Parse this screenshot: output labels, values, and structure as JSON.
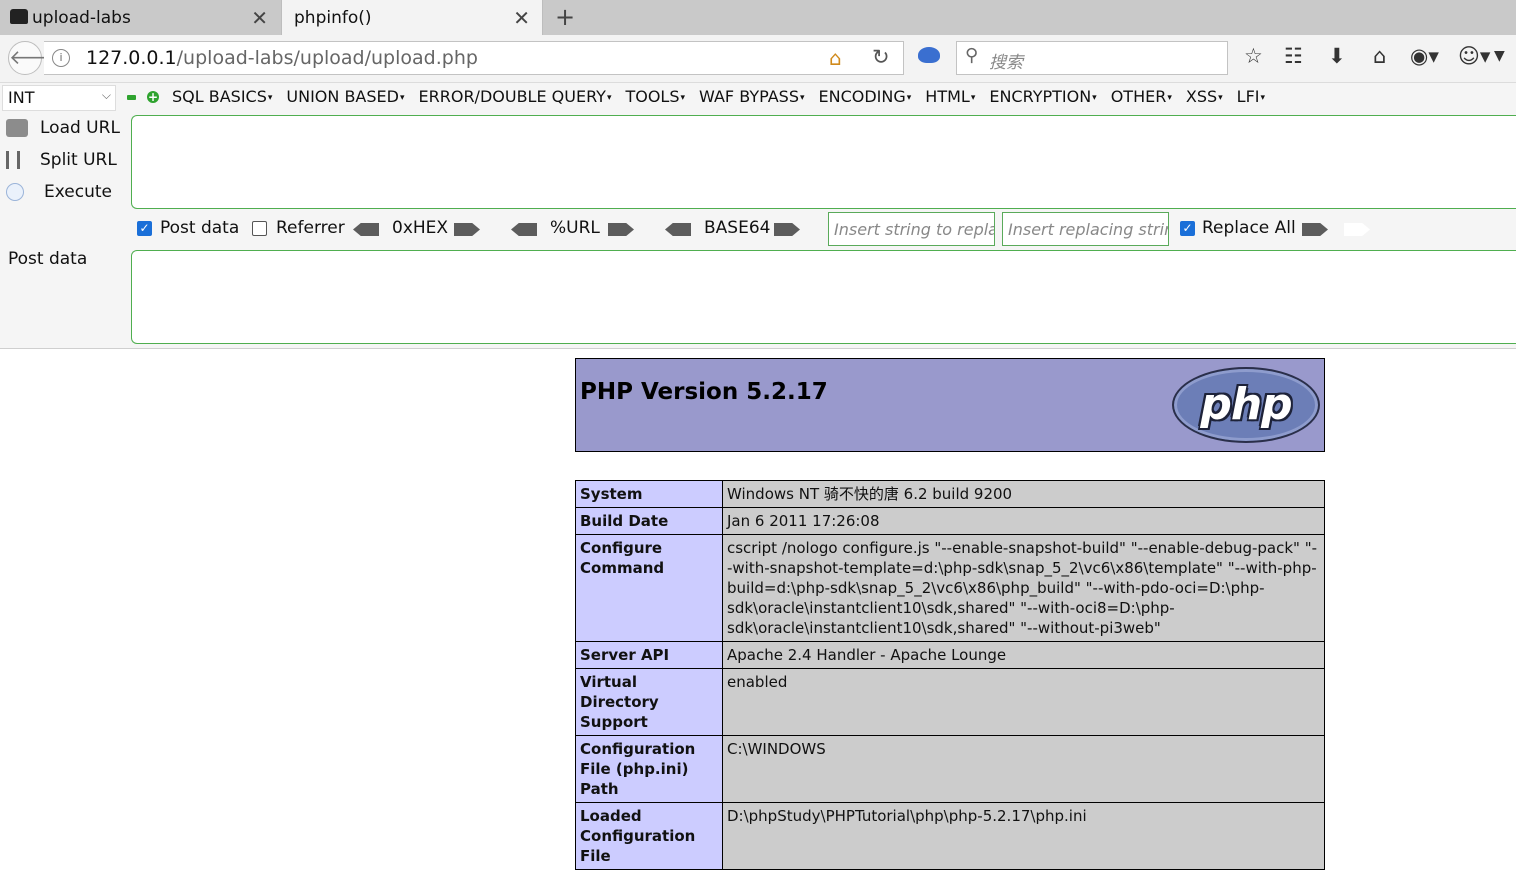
{
  "tabs": [
    {
      "title": "upload-labs"
    },
    {
      "title": "phpinfo()"
    }
  ],
  "navbar": {
    "url_host": "127.0.0.1",
    "url_path": "/upload-labs/upload/upload.php",
    "search_placeholder": "搜索"
  },
  "hackbar": {
    "type_select": "INT",
    "menus": [
      "SQL BASICS",
      "UNION BASED",
      "ERROR/DOUBLE QUERY",
      "TOOLS",
      "WAF BYPASS",
      "ENCODING",
      "HTML",
      "ENCRYPTION",
      "OTHER",
      "XSS",
      "LFI"
    ],
    "load_url": "Load URL",
    "split_url": "Split URL",
    "execute": "Execute",
    "post_data_check": "Post data",
    "post_data_checked": true,
    "referrer_check": "Referrer",
    "referrer_checked": false,
    "hex_label": "0xHEX",
    "url_label": "%URL",
    "base64_label": "BASE64",
    "replace_placeholder": "Insert string to replace",
    "replacing_placeholder": "Insert replacing string",
    "replace_all": "Replace All",
    "replace_all_checked": true,
    "post_data_label": "Post data"
  },
  "phpinfo": {
    "version": "PHP Version 5.2.17",
    "logo_text": "php",
    "rows": [
      {
        "key": "System",
        "value": "Windows NT 骑不快的唐 6.2 build 9200"
      },
      {
        "key": "Build Date",
        "value": "Jan 6 2011 17:26:08"
      },
      {
        "key": "Configure Command",
        "value": "cscript /nologo configure.js \"--enable-snapshot-build\" \"--enable-debug-pack\" \"--with-snapshot-template=d:\\php-sdk\\snap_5_2\\vc6\\x86\\template\" \"--with-php-build=d:\\php-sdk\\snap_5_2\\vc6\\x86\\php_build\" \"--with-pdo-oci=D:\\php-sdk\\oracle\\instantclient10\\sdk,shared\" \"--with-oci8=D:\\php-sdk\\oracle\\instantclient10\\sdk,shared\" \"--without-pi3web\""
      },
      {
        "key": "Server API",
        "value": "Apache 2.4 Handler - Apache Lounge"
      },
      {
        "key": "Virtual Directory Support",
        "value": "enabled"
      },
      {
        "key": "Configuration File (php.ini) Path",
        "value": "C:\\WINDOWS"
      },
      {
        "key": "Loaded Configuration File",
        "value": "D:\\phpStudy\\PHPTutorial\\php\\php-5.2.17\\php.ini"
      }
    ]
  },
  "colors": {
    "php_header_bg": "#9999cc",
    "php_key_bg": "#ccccff",
    "php_value_bg": "#cccccc",
    "hackbar_border": "#4fae4f"
  }
}
